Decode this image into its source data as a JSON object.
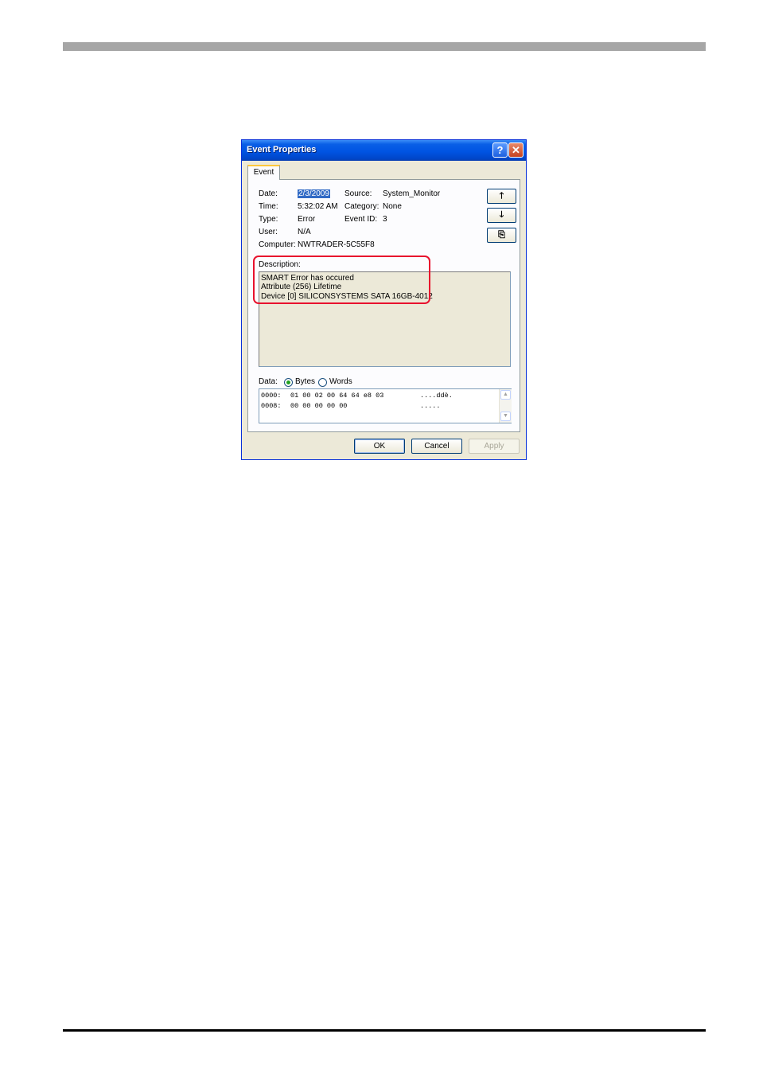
{
  "dialog": {
    "title": "Event Properties",
    "help_glyph": "?",
    "close_glyph": "✕",
    "tab_label": "Event"
  },
  "event": {
    "date_label": "Date:",
    "date_value": "2/3/2009",
    "time_label": "Time:",
    "time_value": "5:32:02 AM",
    "type_label": "Type:",
    "type_value": "Error",
    "user_label": "User:",
    "user_value": "N/A",
    "computer_label": "Computer:",
    "computer_value": "NWTRADER-5C55F8",
    "source_label": "Source:",
    "source_value": "System_Monitor",
    "category_label": "Category:",
    "category_value": "None",
    "event_id_label": "Event ID:",
    "event_id_value": "3"
  },
  "nav": {
    "up_glyph": "🡑",
    "down_glyph": "🡓",
    "copy_glyph": "⎘"
  },
  "description": {
    "label": "Description:",
    "lines": [
      "SMART Error has occured",
      "Attribute (256) Lifetime",
      "Device [0] SILICONSYSTEMS SATA 16GB-4012"
    ]
  },
  "data_section": {
    "label": "Data:",
    "bytes_label": "Bytes",
    "words_label": "Words",
    "selected": "Bytes",
    "rows": [
      {
        "offset": "0000:",
        "hex": "01 00 02 00 64 64 e8 03",
        "ascii": "....ddè."
      },
      {
        "offset": "0008:",
        "hex": "00 00 00 00 00",
        "ascii": "....."
      }
    ]
  },
  "buttons": {
    "ok": "OK",
    "cancel": "Cancel",
    "apply": "Apply"
  },
  "colors": {
    "titlebar": "#0054e3",
    "highlight": "#e8112d",
    "dialog_bg": "#ece9d8"
  }
}
